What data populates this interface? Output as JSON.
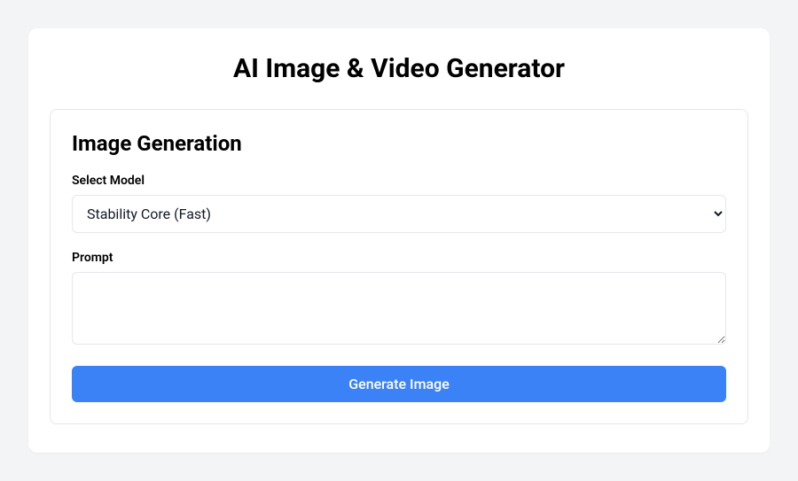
{
  "header": {
    "title": "AI Image & Video Generator"
  },
  "section": {
    "title": "Image Generation",
    "model": {
      "label": "Select Model",
      "selected": "Stability Core (Fast)"
    },
    "prompt": {
      "label": "Prompt",
      "value": ""
    },
    "submit": {
      "label": "Generate Image"
    }
  }
}
